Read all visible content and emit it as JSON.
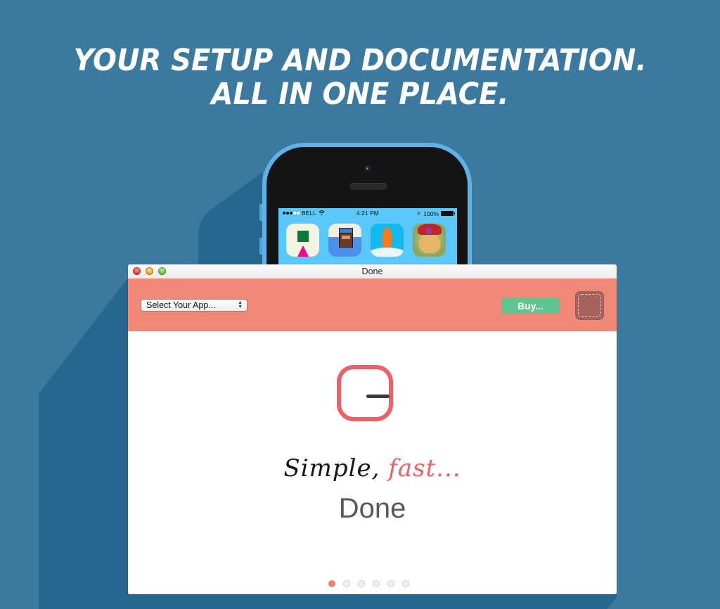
{
  "colors": {
    "background": "#3b7a9e",
    "shadow": "#266790",
    "toolbar": "#f08878",
    "accent_red": "#ef5f66",
    "buy_green": "#5ec490",
    "phone_case": "#5db3e6",
    "phone_screen": "#5ac8fa"
  },
  "headline": {
    "line1": "Your setup and documentation.",
    "line2": "All in one place."
  },
  "phone": {
    "statusbar": {
      "signal_icon": "signal-dots-icon",
      "carrier": "BELL",
      "wifi_icon": "wifi-icon",
      "time": "4:21 PM",
      "bluetooth_icon": "bluetooth-icon",
      "battery": "100%",
      "battery_icon": "battery-icon"
    },
    "apps": [
      {
        "name": "green-square-pink-triangle-app-icon"
      },
      {
        "name": "pixel-bearded-man-app-icon"
      },
      {
        "name": "rocket-app-icon"
      },
      {
        "name": "doge-turban-app-icon"
      }
    ]
  },
  "window": {
    "title": "Done",
    "controls": [
      "close",
      "minimize",
      "zoom"
    ],
    "toolbar": {
      "select_value": "Select Your App...",
      "buy_label": "Buy...",
      "drop_well_icon": "dashed-drop-well-icon"
    },
    "content": {
      "logo_icon": "done-logo-icon",
      "tagline_part1": "Simple,",
      "tagline_part2": "fast...",
      "brand_name": "Done"
    },
    "pagination": {
      "total": 6,
      "active_index": 0
    }
  }
}
